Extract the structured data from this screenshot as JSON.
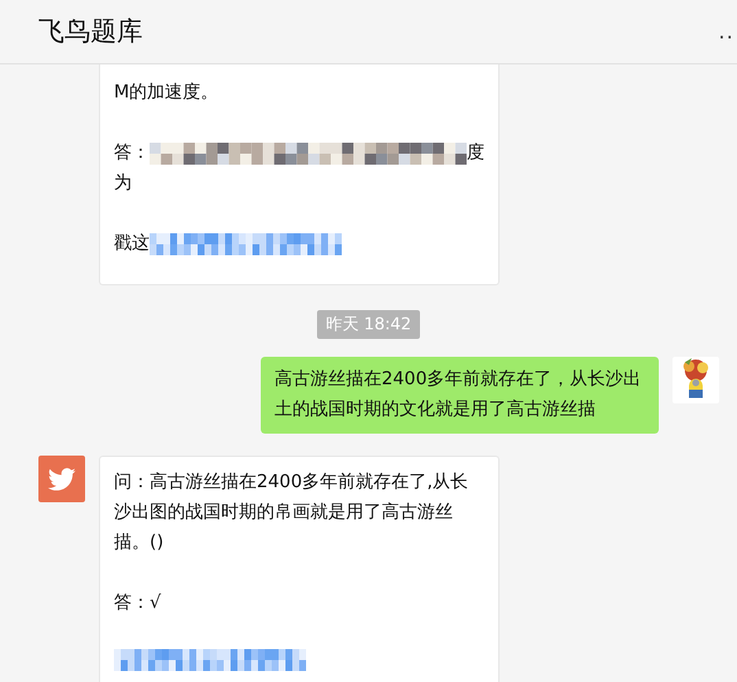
{
  "header": {
    "title": "飞鸟题库",
    "menu": ".."
  },
  "messages": [
    {
      "kind": "card",
      "outgoing": false,
      "avatar": false,
      "paragraphs": [
        [
          [
            {
              "kind": "text",
              "text": "M的加速度。"
            }
          ]
        ],
        [
          [
            {
              "kind": "text",
              "text": "答："
            },
            {
              "kind": "mosaic",
              "link": false
            },
            {
              "kind": "text",
              "text": "度"
            }
          ],
          [
            {
              "kind": "text",
              "text": "为"
            }
          ]
        ],
        [
          [
            {
              "kind": "text",
              "text": "戳这"
            },
            {
              "kind": "mosaic",
              "link": true
            }
          ]
        ]
      ]
    },
    {
      "kind": "time",
      "text": "昨天 18:42"
    },
    {
      "kind": "bubble",
      "outgoing": true,
      "avatar": true,
      "text": "高古游丝描在2400多年前就存在了，从长沙出土的战国时期的文化就是用了高古游丝描"
    },
    {
      "kind": "card",
      "outgoing": false,
      "avatar": true,
      "paragraphs": [
        [
          [
            {
              "kind": "text",
              "text": "问：高古游丝描在2400多年前就存在了,从长沙出图的战国时期的帛画就是用了高古游丝描。()"
            }
          ]
        ],
        [
          [
            {
              "kind": "text",
              "text": "答：√"
            }
          ]
        ],
        [
          [
            {
              "kind": "mosaic",
              "link": true
            }
          ]
        ]
      ]
    }
  ]
}
